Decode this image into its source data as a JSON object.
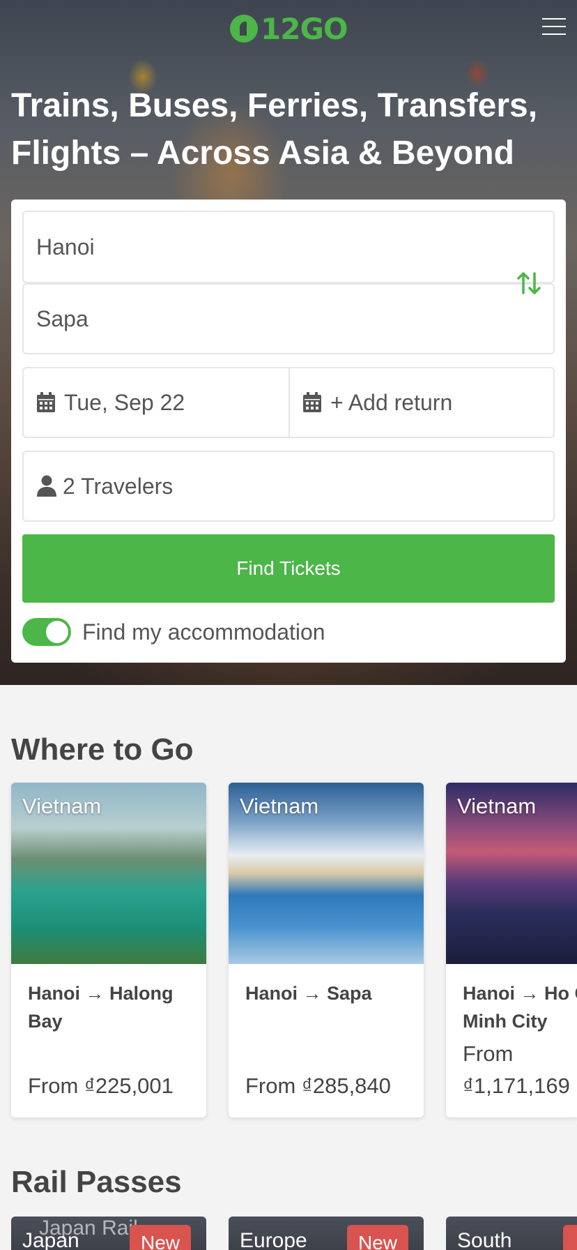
{
  "header": {
    "logo_text": "12GO",
    "menu_icon": "hamburger-icon"
  },
  "hero": {
    "title": "Trains, Buses, Ferries, Transfers, Flights – Across Asia & Beyond"
  },
  "search": {
    "from_value": "Hanoi",
    "to_value": "Sapa",
    "date_value": "Tue, Sep 22",
    "return_label": "+ Add return",
    "travelers_value": "2 Travelers",
    "find_button": "Find Tickets",
    "accommodation_label": "Find my accommodation",
    "accommodation_toggle_on": true
  },
  "where_to_go": {
    "title": "Where to Go",
    "cards": [
      {
        "country": "Vietnam",
        "route": "Hanoi → Halong Bay",
        "price": "From ₫225,001"
      },
      {
        "country": "Vietnam",
        "route": "Hanoi → Sapa",
        "price": "From ₫285,840"
      },
      {
        "country": "Vietnam",
        "route": "Hanoi → Ho Chi Minh City",
        "price": "From ₫1,171,169"
      }
    ]
  },
  "rail_passes": {
    "title": "Rail Passes",
    "cards": [
      {
        "name": "Japan",
        "badge": "New",
        "watermark": "Japan Rail"
      },
      {
        "name": "Europe",
        "badge": "New"
      },
      {
        "name": "South",
        "badge": ""
      }
    ]
  },
  "colors": {
    "brand_green": "#4cb648",
    "badge_red": "#d9534f"
  }
}
